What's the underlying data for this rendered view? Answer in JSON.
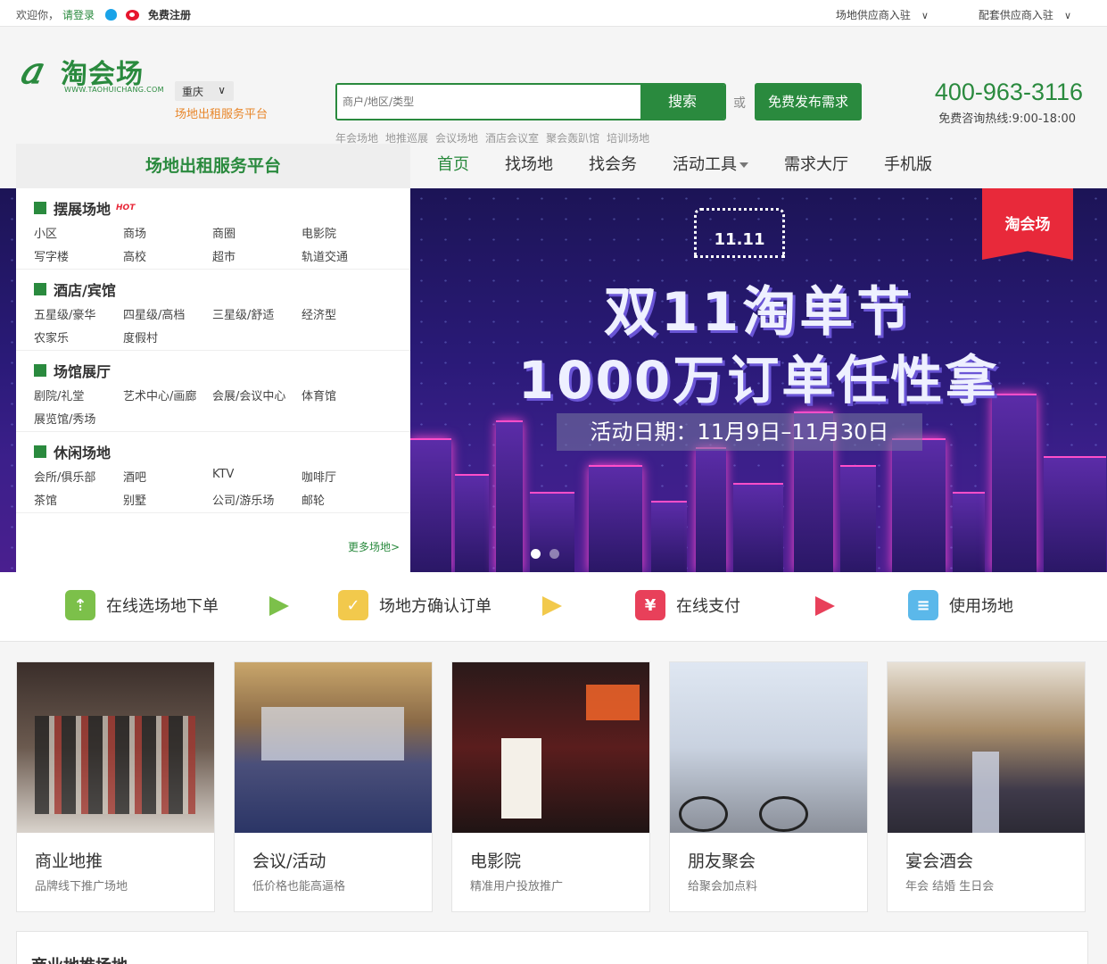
{
  "topbar": {
    "welcome": "欢迎你，",
    "login": "请登录",
    "register": "免费注册",
    "links": [
      "场地供应商入驻",
      "配套供应商入驻"
    ]
  },
  "header": {
    "logo_name": "淘会场",
    "logo_url": "WWW.TAOHUICHANG.COM",
    "city": "重庆",
    "slogan": "场地出租服务平台",
    "search_placeholder": "商户/地区/类型",
    "search_button": "搜索",
    "or": "或",
    "publish_button": "免费发布需求",
    "hot_words": [
      "年会场地",
      "地推巡展",
      "会议场地",
      "酒店会议室",
      "聚会轰趴馆",
      "培训场地"
    ],
    "phone": "400-963-3116",
    "hours": "免费咨询热线:9:00-18:00"
  },
  "nav": {
    "category_title": "场地出租服务平台",
    "items": [
      "首页",
      "找场地",
      "找会务",
      "活动工具",
      "需求大厅",
      "手机版"
    ]
  },
  "categories": [
    {
      "title": "摆展场地",
      "hot": "HOT",
      "items": [
        "小区",
        "商场",
        "商圈",
        "电影院",
        "写字楼",
        "高校",
        "超市",
        "轨道交通"
      ]
    },
    {
      "title": "酒店/宾馆",
      "items": [
        "五星级/豪华",
        "四星级/高档",
        "三星级/舒适",
        "经济型",
        "农家乐",
        "度假村"
      ]
    },
    {
      "title": "场馆展厅",
      "items": [
        "剧院/礼堂",
        "艺术中心/画廊",
        "会展/会议中心",
        "体育馆",
        "展览馆/秀场"
      ]
    },
    {
      "title": "休闲场地",
      "items": [
        "会所/俱乐部",
        "酒吧",
        "KTV",
        "咖啡厅",
        "茶馆",
        "别墅",
        "公司/游乐场",
        "邮轮"
      ]
    }
  ],
  "more_venues": "更多场地>",
  "banner": {
    "badge": "11.11",
    "brand": "淘会场",
    "headline1": "双11淘单节",
    "headline2": "1000万订单任性拿",
    "date": "活动日期：11月9日–11月30日"
  },
  "steps": [
    "在线选场地下单",
    "场地方确认订单",
    "在线支付",
    "使用场地"
  ],
  "step_icons": [
    "arrows-icon",
    "check-icon",
    "yuan-icon",
    "layers-icon"
  ],
  "colors": {
    "brand": "#2a8a3e",
    "hot": "#e8293a",
    "accent": "#e8862a"
  },
  "cards": [
    {
      "title": "商业地推",
      "desc": "品牌线下推广场地"
    },
    {
      "title": "会议/活动",
      "desc": "低价格也能高逼格"
    },
    {
      "title": "电影院",
      "desc": "精准用户投放推广"
    },
    {
      "title": "朋友聚会",
      "desc": "给聚会加点料"
    },
    {
      "title": "宴会酒会",
      "desc": "年会 结婚 生日会"
    }
  ],
  "section": {
    "title": "商业地推场地"
  }
}
